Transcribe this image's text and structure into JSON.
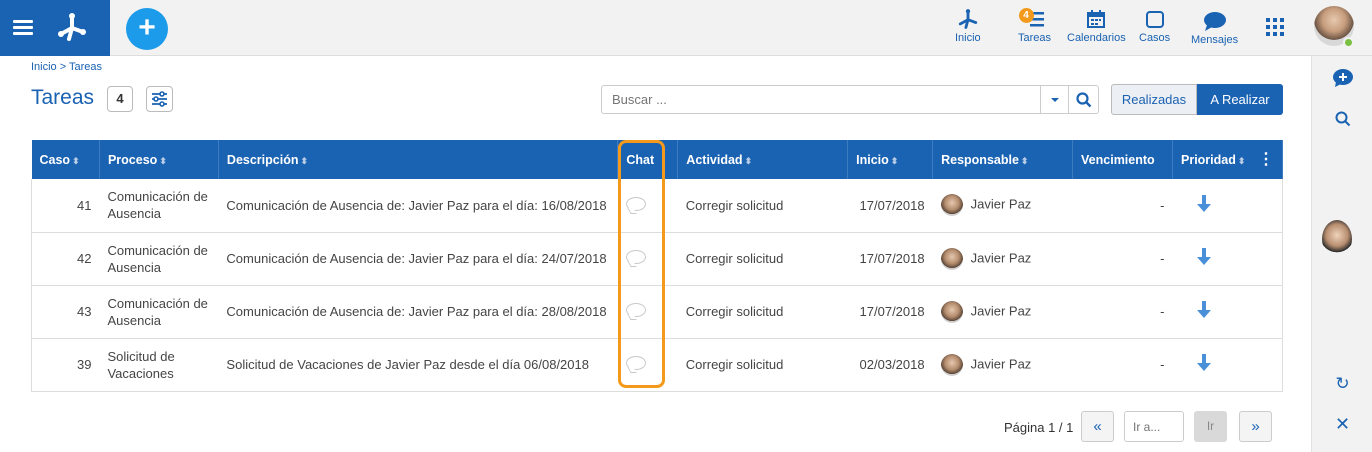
{
  "topbar": {
    "nav": [
      {
        "label": "Inicio",
        "icon": "process-logo-icon"
      },
      {
        "label": "Tareas",
        "icon": "tasks-icon",
        "badge": "4"
      },
      {
        "label": "Calendarios",
        "icon": "calendar-icon"
      },
      {
        "label": "Casos",
        "icon": "cases-icon"
      },
      {
        "label": "Mensajes",
        "icon": "messages-icon"
      }
    ]
  },
  "breadcrumb": "Inicio > Tareas",
  "page": {
    "title": "Tareas",
    "count": "4"
  },
  "search": {
    "placeholder": "Buscar ..."
  },
  "toggle": {
    "done": "Realizadas",
    "todo": "A Realizar"
  },
  "table": {
    "columns": [
      "Caso",
      "Proceso",
      "Descripción",
      "Chat",
      "Actividad",
      "Inicio",
      "Responsable",
      "Vencimiento",
      "Prioridad"
    ],
    "rows": [
      {
        "caso": "41",
        "proceso": "Comunicación de Ausencia",
        "descripcion": "Comunicación de Ausencia de: Javier Paz para el día: 16/08/2018",
        "actividad": "Corregir solicitud",
        "inicio": "17/07/2018",
        "responsable": "Javier Paz",
        "vencimiento": "-"
      },
      {
        "caso": "42",
        "proceso": "Comunicación de Ausencia",
        "descripcion": "Comunicación de Ausencia de: Javier Paz para el día: 24/07/2018",
        "actividad": "Corregir solicitud",
        "inicio": "17/07/2018",
        "responsable": "Javier Paz",
        "vencimiento": "-"
      },
      {
        "caso": "43",
        "proceso": "Comunicación de Ausencia",
        "descripcion": "Comunicación de Ausencia de: Javier Paz para el día: 28/08/2018",
        "actividad": "Corregir solicitud",
        "inicio": "17/07/2018",
        "responsable": "Javier Paz",
        "vencimiento": "-"
      },
      {
        "caso": "39",
        "proceso": "Solicitud de Vacaciones",
        "descripcion": "Solicitud de Vacaciones de Javier  Paz desde el día 06/08/2018",
        "actividad": "Corregir solicitud",
        "inicio": "02/03/2018",
        "responsable": "Javier Paz",
        "vencimiento": "-"
      }
    ]
  },
  "pager": {
    "info": "Página 1 / 1",
    "goto_placeholder": "Ir a...",
    "go": "Ir",
    "first": "«",
    "last": "»"
  },
  "colors": {
    "primary": "#1a62b2",
    "accent": "#f39a1c",
    "plus": "#1b9bea"
  }
}
